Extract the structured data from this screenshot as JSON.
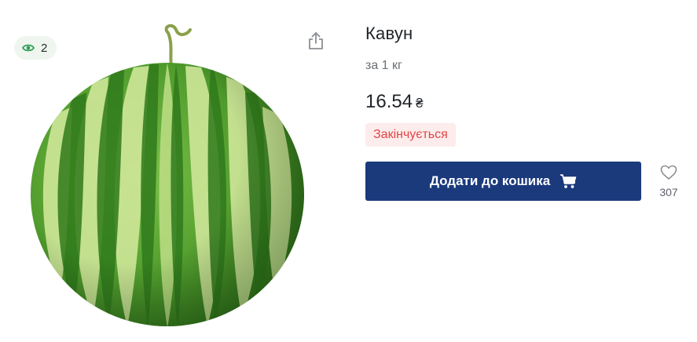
{
  "views": {
    "count": "2",
    "icon": "eye-icon"
  },
  "share": {
    "icon": "share-icon"
  },
  "product": {
    "title": "Кавун",
    "unit": "за 1 кг",
    "price": "16.54",
    "currency": "₴",
    "stock_status": "Закінчується",
    "add_to_cart_label": "Додати до кошика",
    "cart_icon": "cart-icon",
    "favorites_count": "307",
    "favorite_icon": "heart-icon"
  },
  "colors": {
    "button": "#1b3a7c",
    "stock_text": "#e14646",
    "stock_bg": "#fdecec",
    "views_bg": "#eef6ef",
    "eye": "#2e9c52"
  }
}
